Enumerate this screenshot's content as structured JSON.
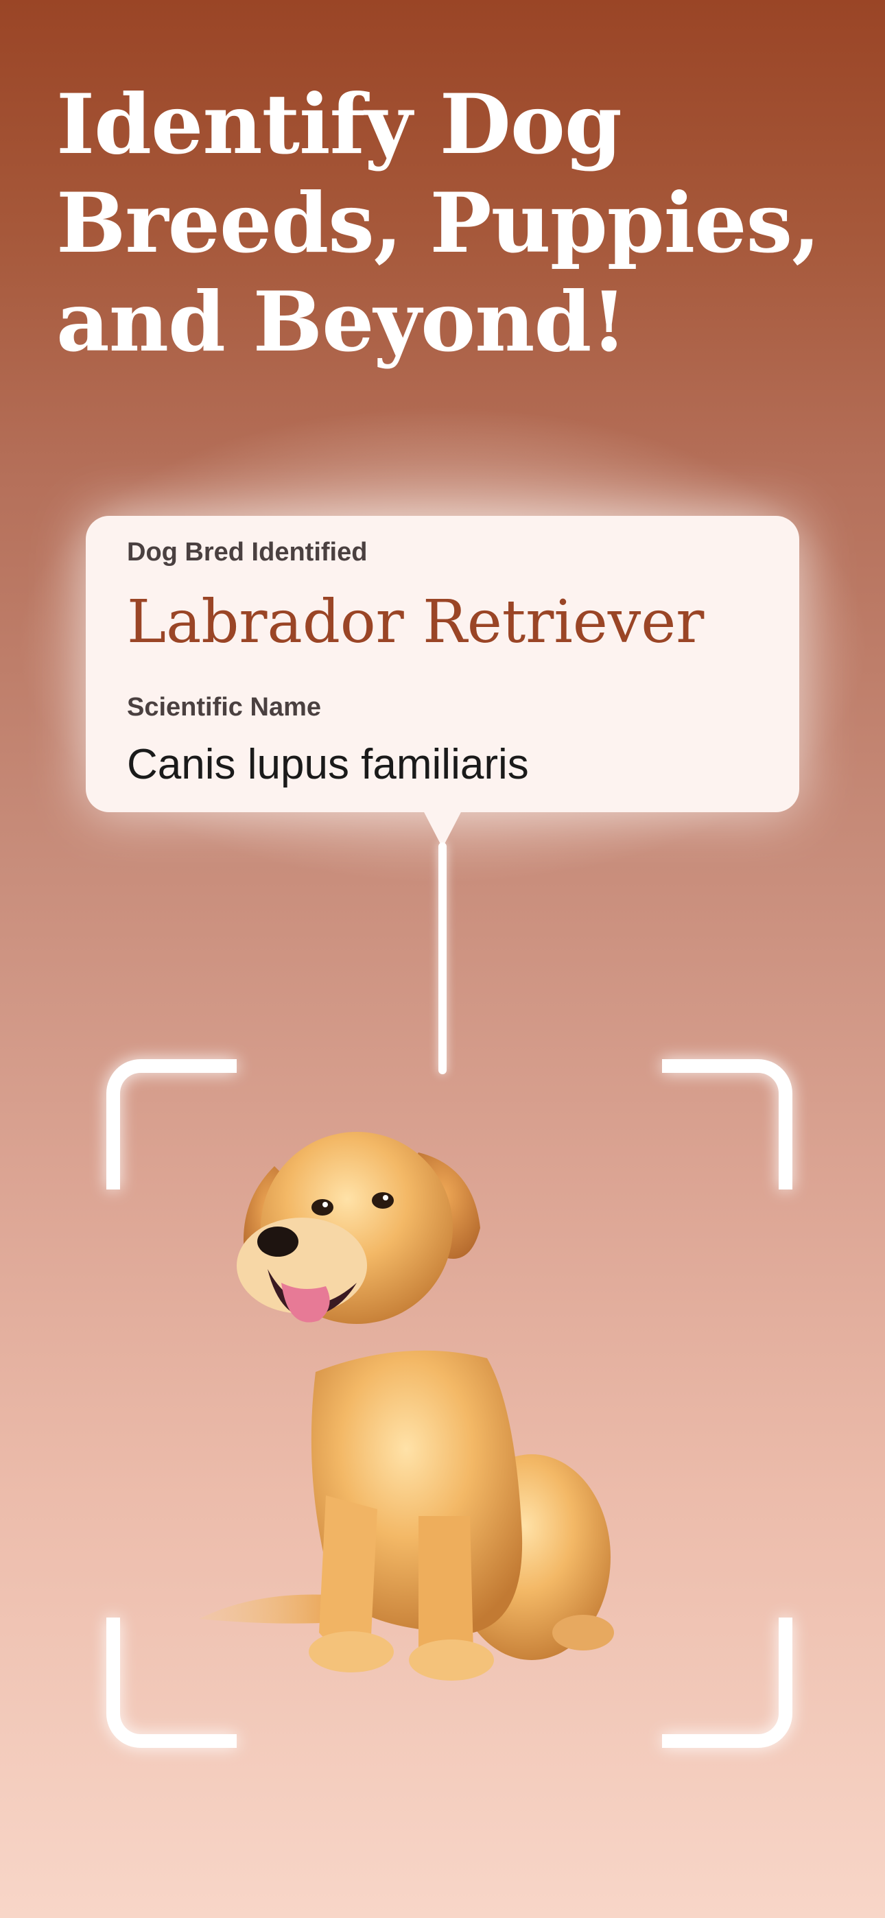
{
  "hero": {
    "headline_lines": [
      "Identify Dog",
      "Breeds, Puppies,",
      "and Beyond!"
    ]
  },
  "result_card": {
    "label": "Dog Bred Identified",
    "breed": "Labrador Retriever",
    "scientific_label": "Scientific Name",
    "scientific_name": "Canis lupus familiaris"
  },
  "colors": {
    "brand": "#9a4526",
    "card_bg": "#fdf3f0",
    "frame": "#ffffff"
  },
  "icons": [
    "scan-frame-icon",
    "dog-illustration"
  ]
}
